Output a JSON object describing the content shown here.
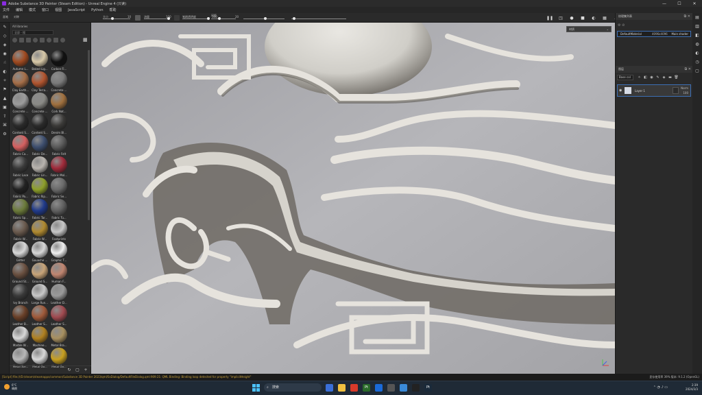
{
  "window": {
    "title": "Adobe Substance 3D Painter (Steam Edition) - Unreal Engine 4 (只读)",
    "minimize": "—",
    "maximize": "☐",
    "close": "✕"
  },
  "menu": [
    "文件",
    "编辑",
    "模式",
    "窗口",
    "视图",
    "JavaScript",
    "Python",
    "帮助"
  ],
  "toolbar": {
    "brush_label": "大小",
    "size_value": "10",
    "flow_label": "流量",
    "flow_value": "100",
    "stroke_opacity_label": "笔刷透明度",
    "opacity_value": "100",
    "spacing_label": "间距",
    "spacing_value": "20",
    "tab_label": "画笔",
    "symmetry": "对称"
  },
  "shelf": {
    "header": "All libraries",
    "search_placeholder": "全部 - 搜",
    "materials": [
      {
        "label": "Autumn L...",
        "color": "#a04a20"
      },
      {
        "label": "Baked Lig...",
        "color": "#d8c9a8"
      },
      {
        "label": "Carbon Fi...",
        "color": "#111111"
      },
      {
        "label": "Clay Earth...",
        "color": "#a56e48"
      },
      {
        "label": "Clay Terra...",
        "color": "#b2552f"
      },
      {
        "label": "Concrete ...",
        "color": "#7a7a7a"
      },
      {
        "label": "Concrete ...",
        "color": "#9c9c9c"
      },
      {
        "label": "Concrete ...",
        "color": "#8a8a86"
      },
      {
        "label": "Cork Nat...",
        "color": "#a0703e"
      },
      {
        "label": "Content S...",
        "color": "#2a2a2a"
      },
      {
        "label": "Content S...",
        "color": "#2a2a2a"
      },
      {
        "label": "Denim Bl...",
        "color": "#3b3a38"
      },
      {
        "label": "Fabric Ca...",
        "color": "#d56060"
      },
      {
        "label": "Fabric De...",
        "color": "#3d4e6e"
      },
      {
        "label": "Fabric Felt",
        "color": "#5a5a5a"
      },
      {
        "label": "Fabric Lace",
        "color": "#3a3a3a"
      },
      {
        "label": "Fabric Lin...",
        "color": "#b8b4ae"
      },
      {
        "label": "Fabric Mol...",
        "color": "#a02a3a"
      },
      {
        "label": "Fabric Pa...",
        "color": "#222222"
      },
      {
        "label": "Fabric Rip...",
        "color": "#8ea02a"
      },
      {
        "label": "Fabric Se...",
        "color": "#6a6a6a"
      },
      {
        "label": "Fabric Sp...",
        "color": "#6b7a3a"
      },
      {
        "label": "Fabric Tar...",
        "color": "#203a8a"
      },
      {
        "label": "Fabric Tu...",
        "color": "#606060"
      },
      {
        "label": "Fabric W...",
        "color": "#6a5a4e"
      },
      {
        "label": "Fabric W...",
        "color": "#b08a30"
      },
      {
        "label": "Footprints",
        "color": "#c8c8c8"
      },
      {
        "label": "Glitter",
        "color": "#d8d8d8"
      },
      {
        "label": "Gouache ...",
        "color": "#d8d8d8"
      },
      {
        "label": "Graphic T...",
        "color": "#f0f0f0"
      },
      {
        "label": "Ground St...",
        "color": "#6a5040"
      },
      {
        "label": "Ground S...",
        "color": "#c8a478"
      },
      {
        "label": "Human F...",
        "color": "#c08570"
      },
      {
        "label": "Ivy Branch",
        "color": "#3a3a3a"
      },
      {
        "label": "Large Run...",
        "color": "#c8c8c8"
      },
      {
        "label": "Leather D...",
        "color": "#9a9a9a"
      },
      {
        "label": "Leather B...",
        "color": "#6a4028"
      },
      {
        "label": "Leather S...",
        "color": "#a05a3a"
      },
      {
        "label": "Leather S...",
        "color": "#a04a50"
      },
      {
        "label": "Marble W...",
        "color": "#d8d8d8"
      },
      {
        "label": "Machine...",
        "color": "#b08020"
      },
      {
        "label": "Metal Bra...",
        "color": "#a89060"
      },
      {
        "label": "Metal Ste...",
        "color": "#b8b8b8"
      },
      {
        "label": "Metal Go...",
        "color": "#d8d8d8"
      },
      {
        "label": "Metal Go...",
        "color": "#c8a020"
      }
    ]
  },
  "viewport": {
    "display_mode": "材质"
  },
  "texture_set": {
    "panel_title": "纹理集列表",
    "name": "DefaultMaterial",
    "resolution": "4096x4096",
    "shader": "Main shader"
  },
  "layers": {
    "panel_title": "图层",
    "blend_channel": "Base col",
    "layer_name": "Layer 1",
    "blend_mode": "Norm",
    "opacity": "100"
  },
  "status": {
    "log": "[Script] file:///D:/steam/steamapps/common/Substance 3D Painter 2023/qml/SsDialog/DefaultFileDialog.qml:909:21: QML Binding: Binding loop detected for property \"implicitHeight\"",
    "right": "显存使用率 39%  版本: 9.1.2 (OpenGL)"
  },
  "taskbar": {
    "weather_temp": "6°C",
    "weather_desc": "晴朗",
    "search_placeholder": "搜索",
    "time": "2:39",
    "date": "2024/3/3"
  }
}
